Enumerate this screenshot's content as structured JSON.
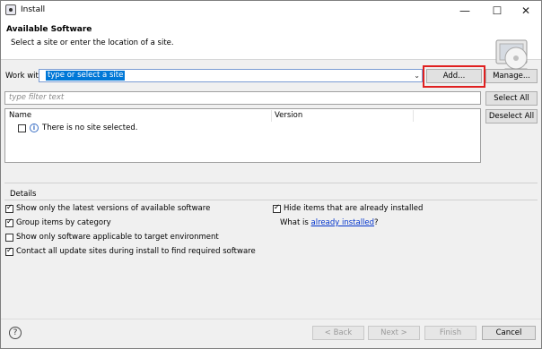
{
  "window": {
    "title": "Install",
    "minimize": "—",
    "maximize": "☐",
    "close": "✕"
  },
  "header": {
    "title": "Available Software",
    "subtitle": "Select a site or enter the location of a site."
  },
  "work_with": {
    "label": "Work with:",
    "value": "type or select a site",
    "add": "Add...",
    "manage": "Manage..."
  },
  "filter": {
    "placeholder": "type filter text",
    "select_all": "Select All",
    "deselect_all": "Deselect All"
  },
  "table": {
    "columns": [
      "Name",
      "Version"
    ],
    "message": "There is no site selected."
  },
  "details": {
    "label": "Details",
    "options": [
      {
        "text": "Show only the latest versions of available software",
        "checked": true
      },
      {
        "text": "Group items by category",
        "checked": true
      },
      {
        "text": "Show only software applicable to target environment",
        "checked": false
      },
      {
        "text": "Contact all update sites during install to find required software",
        "checked": true
      },
      {
        "text": "Hide items that are already installed",
        "checked": true
      }
    ],
    "what_is_prefix": "What is ",
    "what_is_link": "already installed",
    "what_is_suffix": "?"
  },
  "footer": {
    "help": "?",
    "back": "< Back",
    "next": "Next >",
    "finish": "Finish",
    "cancel": "Cancel"
  },
  "colors": {
    "accent": "#0078d7",
    "link": "#0033cc",
    "highlight": "#e02020"
  }
}
